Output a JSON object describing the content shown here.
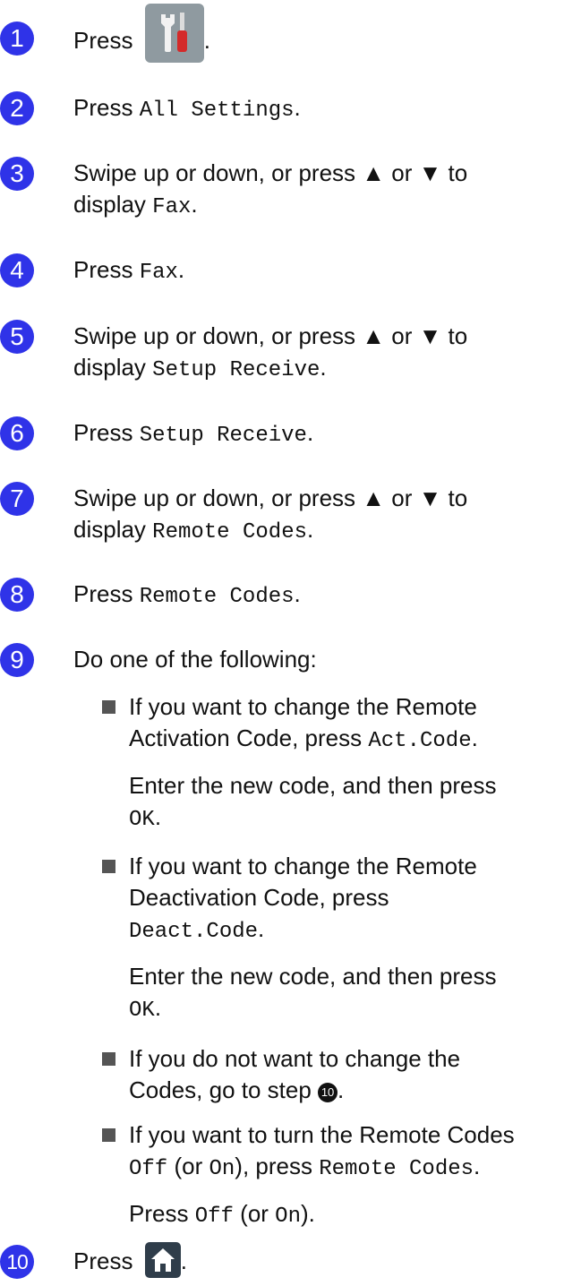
{
  "steps": [
    {
      "num": "1",
      "press": "Press"
    },
    {
      "num": "2",
      "press": "Press",
      "code": "All Settings"
    },
    {
      "num": "3",
      "line1": "Swipe up or down, or press ▲ or ▼ to",
      "display": "display",
      "code": "Fax"
    },
    {
      "num": "4",
      "press": "Press",
      "code": "Fax"
    },
    {
      "num": "5",
      "line1": "Swipe up or down, or press ▲ or ▼ to",
      "display": "display",
      "code": "Setup Receive"
    },
    {
      "num": "6",
      "press": "Press",
      "code": "Setup Receive"
    },
    {
      "num": "7",
      "line1": "Swipe up or down, or press ▲ or ▼ to",
      "display": "display",
      "code": "Remote Codes"
    },
    {
      "num": "8",
      "press": "Press",
      "code": "Remote Codes"
    },
    {
      "num": "9",
      "text": "Do one of the following:"
    },
    {
      "num": "10",
      "press": "Press"
    }
  ],
  "options": {
    "act": {
      "line1": "If you want to change the Remote",
      "line2": "Activation Code, press",
      "code": "Act.Code",
      "sub": "Enter the new code, and then press",
      "ok": "OK"
    },
    "deact": {
      "line1": "If you want to change the Remote",
      "line2": "Deactivation Code, press",
      "code": "Deact.Code",
      "sub": "Enter the new code, and then press",
      "ok": "OK"
    },
    "skip": {
      "line1": "If you do not want to change the",
      "line2": "Codes, go to step",
      "step_ref": "10"
    },
    "toggle": {
      "line1": "If you want to turn the Remote Codes",
      "off": "Off",
      "or_open": "(or",
      "on": "On",
      "or_close": "), press",
      "code": "Remote Codes",
      "sub_press": "Press",
      "sub_off": "Off",
      "sub_or": "(or",
      "sub_on": "On",
      "sub_close": ")."
    }
  },
  "colors": {
    "badge": "#2f33e8",
    "tools_bg": "#8f9aa0",
    "home_bg": "#2f3d4a",
    "accent_red": "#d42a2a"
  },
  "icons": {
    "tools": "tools-settings-icon",
    "home": "home-icon"
  }
}
